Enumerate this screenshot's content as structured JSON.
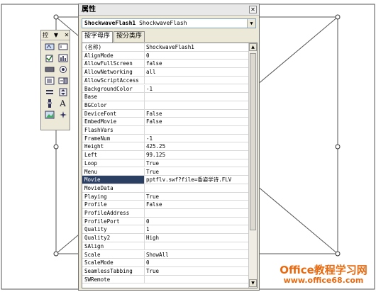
{
  "toolbox": {
    "title": "控",
    "menu_glyph": "▼",
    "close_glyph": "✕",
    "tools": [
      "label-icon",
      "textbox-icon",
      "checkbox-icon",
      "image-control-icon",
      "command-button-icon",
      "option-button-icon",
      "listbox-icon",
      "combobox-icon",
      "toggle-button-icon",
      "spin-button-icon",
      "scrollbar-icon",
      "text-label-icon",
      "picture-icon",
      "more-controls-icon"
    ],
    "text_tool_glyph": "A"
  },
  "properties_window": {
    "title": "属性",
    "close_glyph": "✕",
    "object_select": {
      "name": "ShockwaveFlash1",
      "type": "ShockwaveFlash"
    },
    "tabs": [
      "按字母序",
      "按分类序"
    ],
    "active_tab_index": 0,
    "selected_property": "Movie",
    "rows": [
      {
        "name": "(名称)",
        "value": "ShockwaveFlash1"
      },
      {
        "name": "AlignMode",
        "value": "0"
      },
      {
        "name": "AllowFullScreen",
        "value": "false"
      },
      {
        "name": "AllowNetworking",
        "value": "all"
      },
      {
        "name": "AllowScriptAccess",
        "value": ""
      },
      {
        "name": "BackgroundColor",
        "value": "-1"
      },
      {
        "name": "Base",
        "value": ""
      },
      {
        "name": "BGColor",
        "value": ""
      },
      {
        "name": "DeviceFont",
        "value": "False"
      },
      {
        "name": "EmbedMovie",
        "value": "False"
      },
      {
        "name": "FlashVars",
        "value": ""
      },
      {
        "name": "FrameNum",
        "value": "-1"
      },
      {
        "name": "Height",
        "value": "425.25"
      },
      {
        "name": "Left",
        "value": "99.125"
      },
      {
        "name": "Loop",
        "value": "True"
      },
      {
        "name": "Menu",
        "value": "True"
      },
      {
        "name": "Movie",
        "value": "pptflv.swf?file=香姿学诗.FLV"
      },
      {
        "name": "MovieData",
        "value": ""
      },
      {
        "name": "Playing",
        "value": "True"
      },
      {
        "name": "Profile",
        "value": "False"
      },
      {
        "name": "ProfileAddress",
        "value": ""
      },
      {
        "name": "ProfilePort",
        "value": "0"
      },
      {
        "name": "Quality",
        "value": "1"
      },
      {
        "name": "Quality2",
        "value": "High"
      },
      {
        "name": "SAlign",
        "value": ""
      },
      {
        "name": "Scale",
        "value": "ShowAll"
      },
      {
        "name": "ScaleMode",
        "value": "0"
      },
      {
        "name": "SeamlessTabbing",
        "value": "True"
      },
      {
        "name": "SWRemote",
        "value": ""
      }
    ],
    "scroll_up_glyph": "▲",
    "scroll_down_glyph": "▼",
    "dropdown_glyph": "▼"
  },
  "watermark": {
    "line1": "Office教程学习网",
    "line2": "www.office68.com"
  }
}
